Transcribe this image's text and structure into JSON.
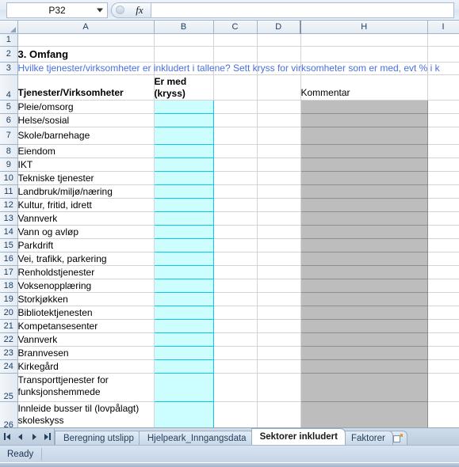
{
  "formula_bar": {
    "name_box_value": "P32",
    "formula_value": "",
    "fx_label": "fx",
    "insert_function_icon": "insert-function-icon",
    "dropdown_icon": "chevron-down-icon"
  },
  "grid": {
    "columns": [
      "A",
      "B",
      "C",
      "D",
      "H",
      "I"
    ],
    "row_numbers": [
      "1",
      "2",
      "3",
      "4",
      "5",
      "6",
      "7",
      "8",
      "9",
      "10",
      "11",
      "12",
      "13",
      "14",
      "15",
      "16",
      "17",
      "18",
      "19",
      "20",
      "21",
      "22",
      "23",
      "24",
      "25",
      "26"
    ],
    "title": "3. Omfang",
    "instruction": "Hvilke tjenester/virksomheter er inkludert i tallene? Sett kryss for virksomheter som er med, evt % i k",
    "header_a": "Tjenester/Virksomheter",
    "header_b_line1": "Er med",
    "header_b_line2": "(kryss)",
    "header_h": "Kommentar",
    "rows": [
      {
        "n": "5",
        "label": "Pleie/omsorg",
        "kryss": "",
        "kommentar": ""
      },
      {
        "n": "6",
        "label": "Helse/sosial",
        "kryss": "",
        "kommentar": ""
      },
      {
        "n": "7",
        "label": "Skole/barnehage",
        "kryss": "",
        "kommentar": ""
      },
      {
        "n": "8",
        "label": "Eiendom",
        "kryss": "",
        "kommentar": ""
      },
      {
        "n": "9",
        "label": "IKT",
        "kryss": "",
        "kommentar": ""
      },
      {
        "n": "10",
        "label": "Tekniske tjenester",
        "kryss": "",
        "kommentar": ""
      },
      {
        "n": "11",
        "label": "Landbruk/miljø/næring",
        "kryss": "",
        "kommentar": ""
      },
      {
        "n": "12",
        "label": "Kultur, fritid, idrett",
        "kryss": "",
        "kommentar": ""
      },
      {
        "n": "13",
        "label": "Vannverk",
        "kryss": "",
        "kommentar": ""
      },
      {
        "n": "14",
        "label": "Vann og avløp",
        "kryss": "",
        "kommentar": ""
      },
      {
        "n": "15",
        "label": "Parkdrift",
        "kryss": "",
        "kommentar": ""
      },
      {
        "n": "16",
        "label": "Vei, trafikk, parkering",
        "kryss": "",
        "kommentar": ""
      },
      {
        "n": "17",
        "label": "Renholdstjenester",
        "kryss": "",
        "kommentar": ""
      },
      {
        "n": "18",
        "label": "Voksenopplæring",
        "kryss": "",
        "kommentar": ""
      },
      {
        "n": "19",
        "label": "Storkjøkken",
        "kryss": "",
        "kommentar": ""
      },
      {
        "n": "20",
        "label": "Bibliotektjenesten",
        "kryss": "",
        "kommentar": ""
      },
      {
        "n": "21",
        "label": "Kompetansesenter",
        "kryss": "",
        "kommentar": ""
      },
      {
        "n": "22",
        "label": "Vannverk",
        "kryss": "",
        "kommentar": ""
      },
      {
        "n": "23",
        "label": "Brannvesen",
        "kryss": "",
        "kommentar": ""
      },
      {
        "n": "24",
        "label": "Kirkegård",
        "kryss": "",
        "kommentar": ""
      },
      {
        "n": "25",
        "label": "Transporttjenester for funksjonshemmede",
        "kryss": "",
        "kommentar": ""
      },
      {
        "n": "26",
        "label": "Innleide busser til (lovpålagt) skoleskyss",
        "kryss": "",
        "kommentar": ""
      }
    ]
  },
  "tabs": {
    "items": [
      {
        "label": "Beregning utslipp",
        "active": false
      },
      {
        "label": "Hjelpeark_Inngangsdata",
        "active": false
      },
      {
        "label": "Sektorer inkludert",
        "active": true
      },
      {
        "label": "Faktorer",
        "active": false
      }
    ],
    "new_sheet_icon": "new-sheet-icon"
  },
  "status_bar": {
    "mode": "Ready"
  },
  "colors": {
    "input_cell_fill": "#ccfdff",
    "input_cell_border": "#12c5e8",
    "comment_cell_fill": "#bdbdbd",
    "instruction_text": "#4a6fe0",
    "header_text": "#1c3f66"
  }
}
